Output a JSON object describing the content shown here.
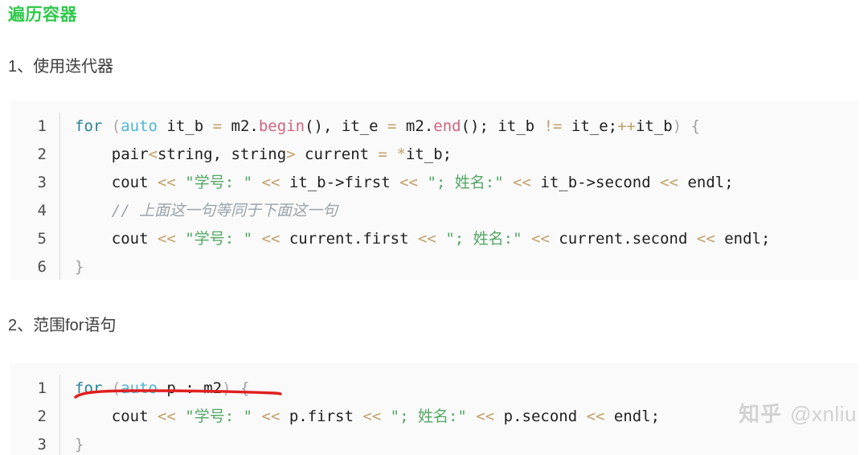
{
  "document": {
    "title": "遍历容器",
    "title_color": "#2ec84a"
  },
  "sections": [
    {
      "heading": "1、使用迭代器",
      "code": {
        "line_numbers": [
          "1",
          "2",
          "3",
          "4",
          "5",
          "6"
        ],
        "lines": [
          "for (auto it_b = m2.begin(), it_e = m2.end(); it_b != it_e;++it_b) {",
          "    pair<string, string> current = *it_b;",
          "    cout << \"学号: \" << it_b->first << \"; 姓名:\" << it_b->second << endl;",
          "    // 上面这一句等同于下面这一句",
          "    cout << \"学号: \" << current.first << \"; 姓名:\" << current.second << endl;",
          "}"
        ]
      }
    },
    {
      "heading": "2、范围for语句",
      "code": {
        "line_numbers": [
          "1",
          "2",
          "3"
        ],
        "lines": [
          "for (auto p : m2) {",
          "    cout << \"学号: \" << p.first << \"; 姓名:\" << p.second << endl;",
          "}"
        ]
      }
    }
  ],
  "tokens": {
    "s1": {
      "l1": {
        "kw_for": "for",
        "paren_open": " (",
        "type_auto": "auto",
        "var1": " it_b ",
        "op_eq1": "=",
        "obj1": " m2",
        "dot1": ".",
        "fn_begin": "begin",
        "punc1": "(), ",
        "var2": "it_e ",
        "op_eq2": "=",
        "obj2": " m2",
        "dot2": ".",
        "fn_end": "end",
        "punc2": "(); ",
        "var3": "it_b ",
        "op_ne": "!=",
        "var4": " it_e;",
        "op_inc": "++",
        "var5": "it_b",
        "paren_close": ")",
        "brace": " {"
      },
      "l2": {
        "indent": "    ",
        "name_pair": "pair",
        "op_lt": "<",
        "name_string1": "string, string",
        "op_gt": ">",
        "name_current": " current ",
        "op_eq": "=",
        "op_star": " *",
        "tail": "it_b;"
      },
      "l3": {
        "indent": "    ",
        "cout": "cout ",
        "op1": "<<",
        "str1": " \"学号: \" ",
        "op2": "<<",
        "mid": " it_b->first ",
        "op3": "<<",
        "str2": " \"; 姓名:\" ",
        "op4": "<<",
        "mid2": " it_b->second ",
        "op5": "<<",
        "tail": " endl;"
      },
      "l4": {
        "indent": "    ",
        "comment": "// 上面这一句等同于下面这一句"
      },
      "l5": {
        "indent": "    ",
        "cout": "cout ",
        "op1": "<<",
        "str1": " \"学号: \" ",
        "op2": "<<",
        "mid": " current.first ",
        "op3": "<<",
        "str2": " \"; 姓名:\" ",
        "op4": "<<",
        "mid2": " current.second ",
        "op5": "<<",
        "tail": " endl;"
      },
      "l6": {
        "brace": "}"
      }
    },
    "s2": {
      "l1": {
        "kw_for": "for",
        "paren_open": " (",
        "type_auto": "auto",
        "var": " p ",
        "colon": ":",
        "obj": " m2",
        "paren_close": ")",
        "brace": " {"
      },
      "l2": {
        "indent": "    ",
        "cout": "cout ",
        "op1": "<<",
        "str1": " \"学号: \" ",
        "op2": "<<",
        "mid": " p.first ",
        "op3": "<<",
        "str2": " \"; 姓名:\" ",
        "op4": "<<",
        "mid2": " p.second ",
        "op5": "<<",
        "tail": " endl;"
      },
      "l3": {
        "brace": "}"
      }
    }
  },
  "annotation": {
    "type": "hand-drawn-underline",
    "color": "#e02020",
    "targets": "for (auto p : m2)"
  },
  "watermark": {
    "logo": "知乎",
    "handle": "@xnliu"
  }
}
